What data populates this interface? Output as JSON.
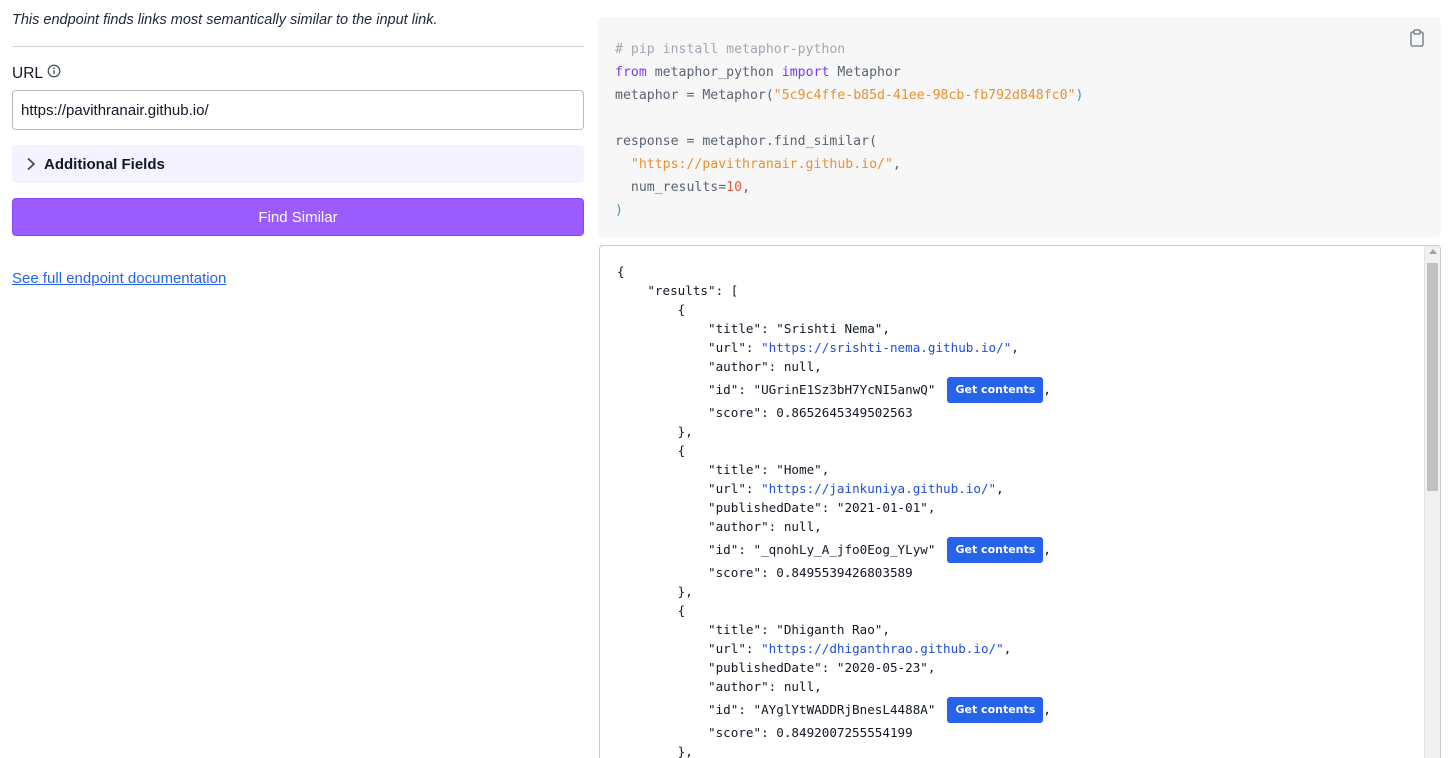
{
  "left": {
    "description": "This endpoint finds links most semantically similar to the input link.",
    "url_label": "URL",
    "url_value": "https://pavithranair.github.io/",
    "additional_fields_label": "Additional Fields",
    "find_button_label": "Find Similar",
    "doc_link_label": "See full endpoint documentation"
  },
  "code": {
    "line1": "# pip install metaphor-python",
    "line2_from": "from",
    "line2_mod": " metaphor_python ",
    "line2_import": "import",
    "line2_cls": " Metaphor",
    "line3_a": "metaphor = Metaphor(",
    "line3_key": "\"5c9c4ffe-b85d-41ee-98cb-fb792d848fc0\"",
    "line3_b": ")",
    "line5": "response = metaphor.find_similar(",
    "line6": "\"https://pavithranair.github.io/\"",
    "line6_comma": ",",
    "line7_a": "num_results=",
    "line7_num": "10",
    "line7_b": ",",
    "line8": ")"
  },
  "json": {
    "open_brace": "{",
    "results_key": "\"results\": [",
    "get_contents_label": "Get contents",
    "results": [
      {
        "title": "\"title\": \"Srishti Nema\",",
        "url_key": "\"url\": ",
        "url": "\"https://srishti-nema.github.io/\"",
        "author": "\"author\": null,",
        "id": "\"id\": \"UGrinE1Sz3bH7YcNI5anwQ\"",
        "score": "\"score\": 0.8652645349502563"
      },
      {
        "title": "\"title\": \"Home\",",
        "url_key": "\"url\": ",
        "url": "\"https://jainkuniya.github.io/\"",
        "published": "\"publishedDate\": \"2021-01-01\",",
        "author": "\"author\": null,",
        "id": "\"id\": \"_qnohLy_A_jfo0Eog_YLyw\"",
        "score": "\"score\": 0.8495539426803589"
      },
      {
        "title": "\"title\": \"Dhiganth Rao\",",
        "url_key": "\"url\": ",
        "url": "\"https://dhiganthrao.github.io/\"",
        "published": "\"publishedDate\": \"2020-05-23\",",
        "author": "\"author\": null,",
        "id": "\"id\": \"AYglYtWADDRjBnesL4488A\"",
        "score": "\"score\": 0.8492007255554199"
      }
    ]
  },
  "colors": {
    "accent_button": "#9b5cff",
    "get_contents_button": "#2563eb",
    "link": "#2563eb"
  }
}
